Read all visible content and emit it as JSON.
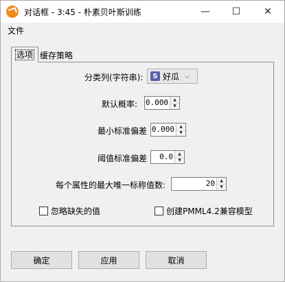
{
  "window": {
    "title": "对话框 - 3:45 - 朴素贝叶斯训练",
    "minimize": "—",
    "maximize": "☐",
    "close": "✕"
  },
  "menu": {
    "file": "文件"
  },
  "tabs": [
    {
      "label": "选项",
      "active": true
    },
    {
      "label": "缓存策略",
      "active": false
    }
  ],
  "options": {
    "class_column": {
      "label": "分类列(字符串):",
      "badge": "S",
      "value": "好瓜"
    },
    "default_prob": {
      "label": "默认概率:",
      "value": "0.000"
    },
    "min_std": {
      "label": "最小标准偏差",
      "value": "0.000"
    },
    "threshold_std": {
      "label": "阈值标准偏差",
      "value": "0.0"
    },
    "max_unique": {
      "label": "每个属性的最大唯一标称值数:",
      "value": "20"
    },
    "ignore_missing": {
      "label": "忽略缺失的值",
      "checked": false
    },
    "pmml_compat": {
      "label": "创建PMML4.2兼容模型",
      "checked": false
    }
  },
  "buttons": {
    "ok": "确定",
    "apply": "应用",
    "cancel": "取消"
  },
  "colors": {
    "icon": "#f28a1e",
    "badge": "#5a5fa8"
  }
}
